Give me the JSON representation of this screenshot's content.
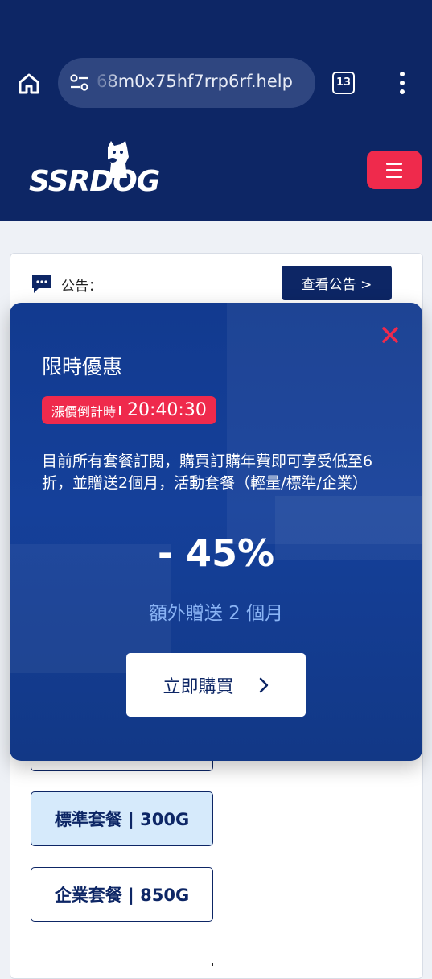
{
  "browser": {
    "url": "68m0x75hf7rrp6rf.help",
    "tab_count": "13"
  },
  "site": {
    "logo_text": "SSRDOG"
  },
  "notice": {
    "label": "公告：",
    "view_button": "查看公告 >"
  },
  "promo": {
    "title": "限時優惠",
    "countdown_label": "漲價倒計時",
    "countdown_time": "20:40:30",
    "description": "目前所有套餐訂閱，購買訂購年費即可享受低至6折，並贈送2個月，活動套餐（輕量/標準/企業）",
    "discount": "- 45%",
    "bonus": "額外贈送 2 個月",
    "buy_button": "立即購買"
  },
  "plans": [
    {
      "label": "標準套餐 | 300G",
      "selected": true
    },
    {
      "label": "企業套餐 | 850G",
      "selected": false
    }
  ],
  "colors": {
    "navy": "#0d2665",
    "accent_red": "#ef2a4c",
    "promo_blue": "#15409a",
    "selected_plan_bg": "#d6eafb"
  }
}
